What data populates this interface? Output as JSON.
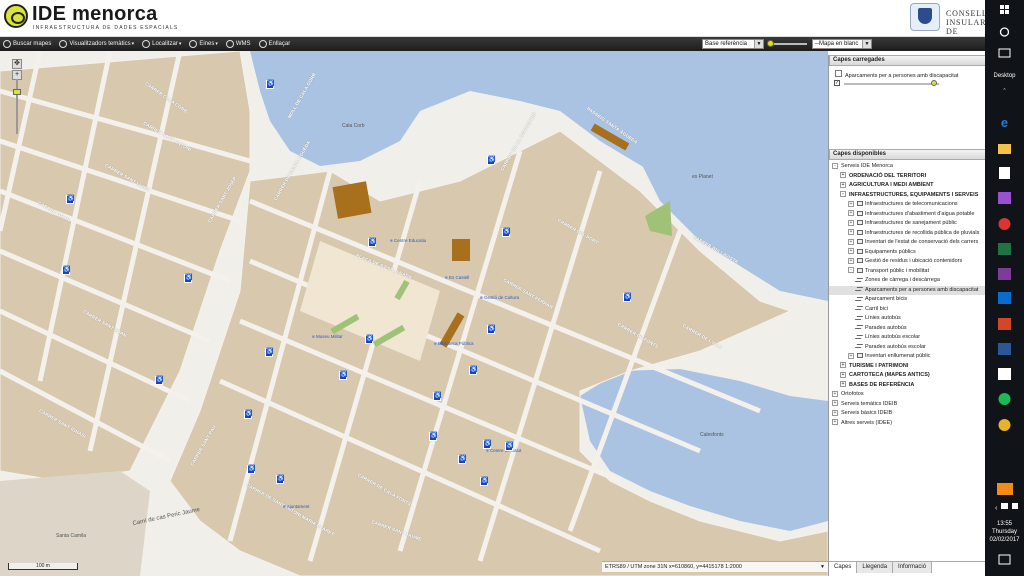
{
  "header": {
    "app_title": "IDE menorca",
    "app_subtitle": "INFRAESTRUCTURA DE DADES ESPACIALS",
    "org_line1": "CONSELL INSULAR",
    "org_line2": "DE MENORCA"
  },
  "toolbar": {
    "items": [
      "Buscar mapes",
      "Visualitzadors temàtics",
      "Localitzar",
      "Eines",
      "WMS",
      "Enllaçar"
    ],
    "base_select_value": "Base referència",
    "blank_select_value": "--Mapa en blanc"
  },
  "map": {
    "scale_label": "100 m",
    "status_text": "ETRS89 / UTM zone 31N    x=610860, y=4415178  1:2000",
    "labels": {
      "cala_corb": "Cala Corb",
      "es_planet": "es Planet",
      "calesfonts": "Calesfonts",
      "cami_perot": "Camí de cas Peric Jaume",
      "santa_camila": "Santa Camila"
    },
    "streets": [
      "CARRER CALA CORB",
      "MOLL DE CALA CORB",
      "CARRER SANT ANTONI",
      "CARRER DE SANTA ÀGUEDA",
      "CARRER SANT LLUÍS",
      "CARRER SANT JOSEP",
      "CARRER DE LA CONCEPCIÓ",
      "CARRER DEL PORT",
      "CARRER BELLAVISTA",
      "CARRER SANT JOAN",
      "PLAÇA DE S'ESPLANADA",
      "CARRER SANT FERRAN",
      "CARRER DE CALA FONTS",
      "CARRER DE FONTS",
      "CARRER DE L'ILLA",
      "CARRER SANT IGNASI",
      "CARRER GRAN",
      "PASSEIG SANTA ÀGUEDA",
      "CARRER SANT PAU",
      "CARRER SANT JAUME",
      "CARRER DE SANT ANTONI MARIA CLARET"
    ],
    "pois": [
      "Centre Educatiu",
      "Es Castell",
      "Gestió de Cultura",
      "Museu Militar",
      "Biblioteca Pública",
      "Centre de Salut",
      "Ajuntament"
    ]
  },
  "panel": {
    "loaded_title": "Capes carregades",
    "loaded_layer": "Aparcaments per a persones amb discapacitat",
    "available_title": "Capes disponibles",
    "tree": [
      {
        "level": 0,
        "toggle": "-",
        "label": "Serveis IDE Menorca",
        "style": "normal"
      },
      {
        "level": 1,
        "toggle": "+",
        "label": "ORDENACIÓ DEL TERRITORI",
        "style": "bold"
      },
      {
        "level": 1,
        "toggle": "+",
        "label": "AGRICULTURA I MEDI AMBIENT",
        "style": "bold"
      },
      {
        "level": 1,
        "toggle": "-",
        "label": "INFRAESTRUCTURES, EQUIPAMENTS I SERVEIS",
        "style": "bold"
      },
      {
        "level": 2,
        "toggle": "+",
        "label": "Infraestructures de telecomunicacions",
        "style": "folder"
      },
      {
        "level": 2,
        "toggle": "+",
        "label": "Infraestructures d'abastiment d'aigua potable",
        "style": "folder"
      },
      {
        "level": 2,
        "toggle": "+",
        "label": "Infraestructures de sanejament públic",
        "style": "folder"
      },
      {
        "level": 2,
        "toggle": "+",
        "label": "Infraestructures de recollida pública de pluvials",
        "style": "folder"
      },
      {
        "level": 2,
        "toggle": "+",
        "label": "Inventari de l'estat de conservació dels carrers",
        "style": "folder"
      },
      {
        "level": 2,
        "toggle": "+",
        "label": "Equipaments públics",
        "style": "folder"
      },
      {
        "level": 2,
        "toggle": "+",
        "label": "Gestió de residus i ubicació contenidors",
        "style": "folder"
      },
      {
        "level": 2,
        "toggle": "-",
        "label": "Transport públic i mobilitat",
        "style": "folder"
      },
      {
        "level": 3,
        "toggle": "",
        "label": "Zones de càrrega i descàrrega",
        "style": "layer"
      },
      {
        "level": 3,
        "toggle": "",
        "label": "Aparcaments per a persones amb discapacitat",
        "style": "layer-sel"
      },
      {
        "level": 3,
        "toggle": "",
        "label": "Aparcament bicis",
        "style": "layer"
      },
      {
        "level": 3,
        "toggle": "",
        "label": "Carril bici",
        "style": "layer"
      },
      {
        "level": 3,
        "toggle": "",
        "label": "Línies autobús",
        "style": "layer"
      },
      {
        "level": 3,
        "toggle": "",
        "label": "Parades autobús",
        "style": "layer"
      },
      {
        "level": 3,
        "toggle": "",
        "label": "Línies autobús escolar",
        "style": "layer"
      },
      {
        "level": 3,
        "toggle": "",
        "label": "Parades autobús escolar",
        "style": "layer"
      },
      {
        "level": 2,
        "toggle": "+",
        "label": "Inventari enllumenat públic",
        "style": "folder"
      },
      {
        "level": 1,
        "toggle": "+",
        "label": "TURISME I PATRIMONI",
        "style": "bold"
      },
      {
        "level": 1,
        "toggle": "+",
        "label": "CARTOTECA (MAPES ANTICS)",
        "style": "bold"
      },
      {
        "level": 1,
        "toggle": "+",
        "label": "BASES DE REFERÈNCIA",
        "style": "bold"
      },
      {
        "level": 0,
        "toggle": "+",
        "label": "Ortofotos",
        "style": "normal"
      },
      {
        "level": 0,
        "toggle": "+",
        "label": "Serveis temàtics IDEIB",
        "style": "normal"
      },
      {
        "level": 0,
        "toggle": "+",
        "label": "Serveis bàsics IDEIB",
        "style": "normal"
      },
      {
        "level": 0,
        "toggle": "+",
        "label": "Altres serveis (IDEE)",
        "style": "normal"
      }
    ],
    "tabs": [
      "Capes",
      "Llegenda",
      "Informació"
    ]
  },
  "taskbar": {
    "desktop_label": "Desktop",
    "time": "13:55",
    "day": "Thursday",
    "date": "02/02/2017"
  },
  "colors": {
    "sea": "#aac3e2",
    "block": "#d7c8ae",
    "street": "#f4f1ec",
    "highlight": "#a8701c",
    "park": "#9fc277",
    "parking_icon": "#1b3fc4"
  }
}
